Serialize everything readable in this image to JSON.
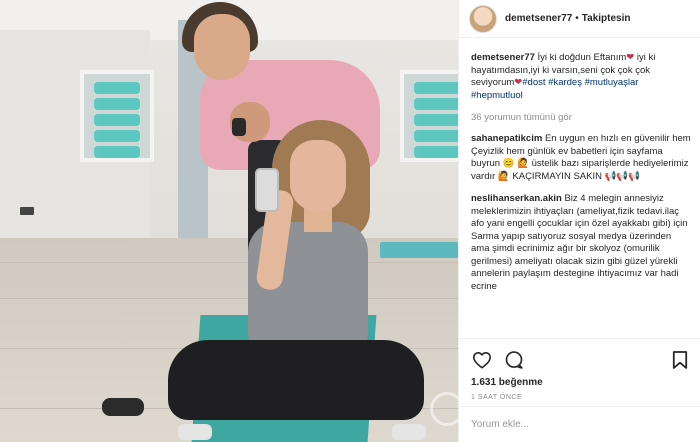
{
  "header": {
    "username": "demetsener77",
    "separator": "•",
    "follow_status": "Takiptesin"
  },
  "caption": {
    "username": "demetsener77",
    "text_1": "İyi ki doğdun Eftanım",
    "heart": "❤",
    "text_2": "iyi ki hayatımdasın,iyi ki varsın,seni çok çok çok seviyorum",
    "heart_2": "❤",
    "tag_1": "#dost",
    "tag_2": "#kardeş",
    "tag_3": "#mutluyaşlar",
    "tag_4": "#hepmutluol"
  },
  "view_all_comments": "36 yorumun tümünü gör",
  "comments": [
    {
      "username": "sahanepatikcim",
      "text": "En uygun en hızlı en güvenilir hem Çeyizlik hem günlük ev babetleri için sayfama buyrun 😊 🙋 üstelik bazı siparişlerde hediyelerimiz vardır 🙋 KAÇIRMAYIN SAKIN 📢📢📢"
    },
    {
      "username": "neslihanserkan.akin",
      "text": "Biz 4 melegin annesiyiz meleklerimizin ihtiyaçları (ameliyat,fizik tedavi.ilaç afo yani engelli çocuklar için özel ayakkabı gibi) için Sarma yapıp satıyoruz sosyal medya üzerinden ama şimdi ecrinimiz ağır bir skolyoz (omurilik gerilmesi) ameliyatı olacak sizin gibi güzel yürekli annelerin paylaşım destegine ihtiyacımız var hadi ecrine"
    }
  ],
  "likes": "1.631 beğenme",
  "time_ago": "1 SAAT ÖNCE",
  "add_comment": {
    "placeholder": "Yorum ekle..."
  },
  "icons": {
    "like": "heart-outline-icon",
    "comment": "speech-bubble-icon",
    "save": "bookmark-icon"
  }
}
